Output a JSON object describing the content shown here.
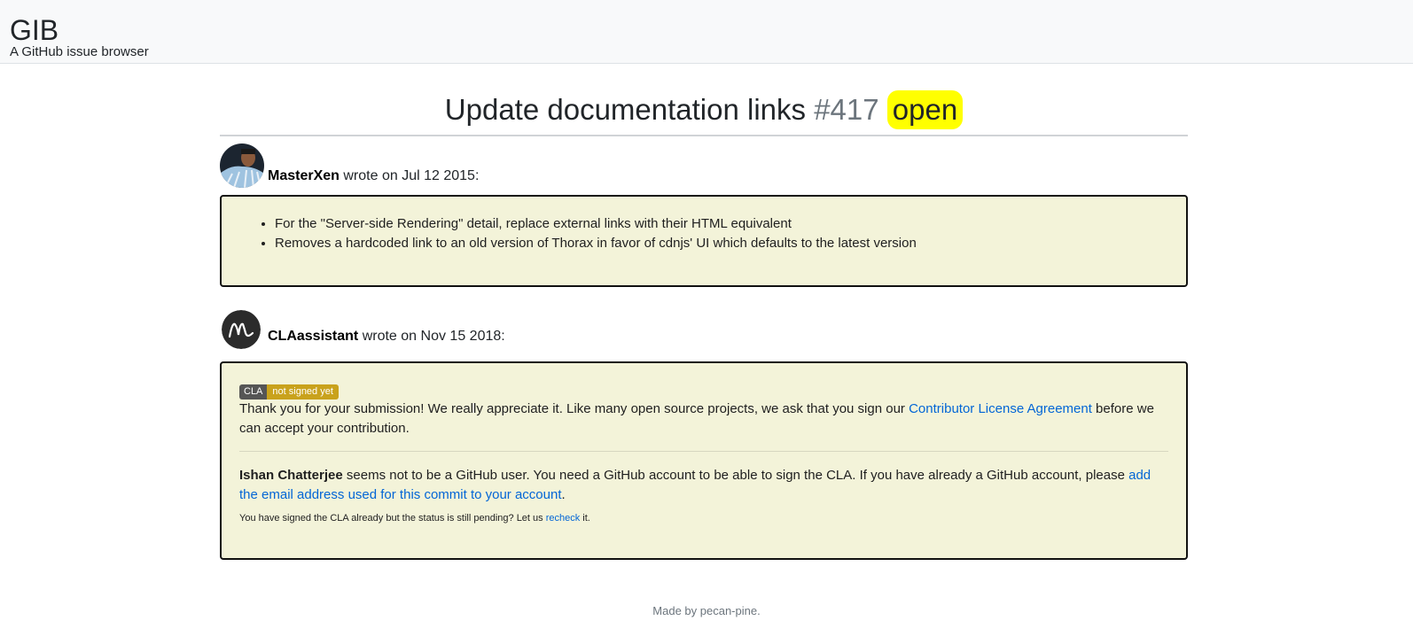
{
  "header": {
    "brand": "GIB",
    "tagline": "A GitHub issue browser"
  },
  "issue": {
    "title": "Update documentation links",
    "number": "#417",
    "state": "open",
    "state_color": "#ffff00"
  },
  "comments": [
    {
      "author": "MasterXen",
      "wrote": "wrote on",
      "date": "Jul 12 2015:",
      "bullets": [
        "For the \"Server-side Rendering\" detail, replace external links with their HTML equivalent",
        "Removes a hardcoded link to an old version of Thorax in favor of cdnjs' UI which defaults to the latest version"
      ]
    },
    {
      "author": "CLAassistant",
      "wrote": "wrote on",
      "date": "Nov 15 2018:",
      "badge": {
        "left": "CLA",
        "right": "not signed yet"
      },
      "para1_before": "Thank you for your submission! We really appreciate it. Like many open source projects, we ask that you sign our ",
      "para1_link": "Contributor License Agreement",
      "para1_after": " before we can accept your contribution.",
      "para2_name": "Ishan Chatterjee",
      "para2_text": " seems not to be a GitHub user. You need a GitHub account to be able to sign the CLA. If you have already a GitHub account, please ",
      "para2_link": "add the email address used for this commit to your account",
      "para2_end": ".",
      "small_before": "You have signed the CLA already but the status is still pending? Let us ",
      "small_link": "recheck",
      "small_after": " it."
    }
  ],
  "footer": "Made by pecan-pine.",
  "colors": {
    "comment_bg": "#f3f3d9",
    "link": "#0366d6"
  }
}
